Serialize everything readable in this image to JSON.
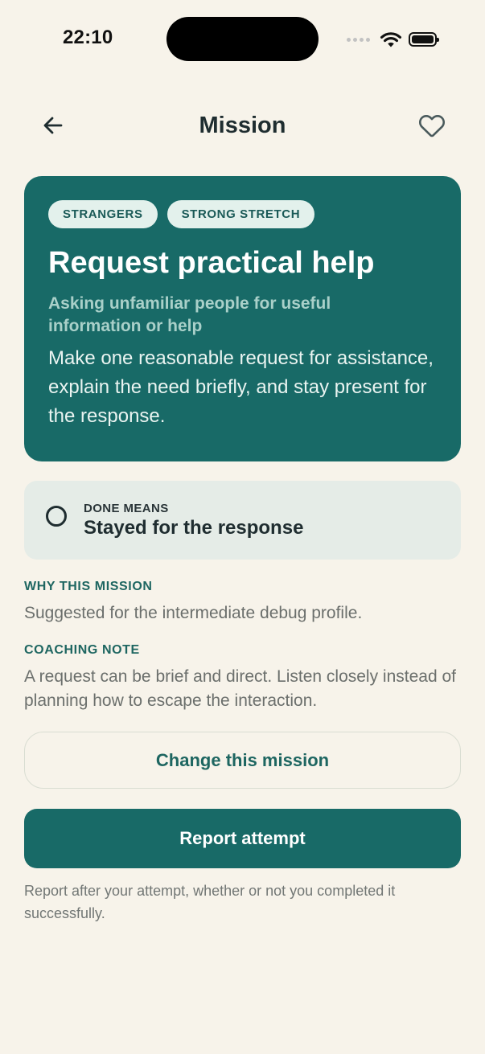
{
  "status_bar": {
    "time": "22:10"
  },
  "header": {
    "title": "Mission",
    "back_icon": "arrow-left-icon",
    "favorite_icon": "heart-outline-icon"
  },
  "mission": {
    "tags": [
      "STRANGERS",
      "STRONG STRETCH"
    ],
    "title": "Request practical help",
    "subtitle": "Asking unfamiliar people for useful information or help",
    "description": "Make one reasonable request for assistance, explain the need briefly, and stay present for the response."
  },
  "done_means": {
    "label": "DONE MEANS",
    "value": "Stayed for the response",
    "checked": false
  },
  "why": {
    "label": "WHY THIS MISSION",
    "text": "Suggested for the intermediate debug profile."
  },
  "coaching": {
    "label": "COACHING NOTE",
    "text": "A request can be brief and direct. Listen closely instead of planning how to escape the interaction."
  },
  "actions": {
    "change_label": "Change this mission",
    "report_label": "Report attempt"
  },
  "footnote": "Report after your attempt, whether or not you completed it successfully.",
  "colors": {
    "primary": "#186a67",
    "background": "#f7f3ea",
    "tag_bg": "#e3f1ec",
    "done_card_bg": "#e5ece7",
    "accent_text": "#1e6661"
  }
}
